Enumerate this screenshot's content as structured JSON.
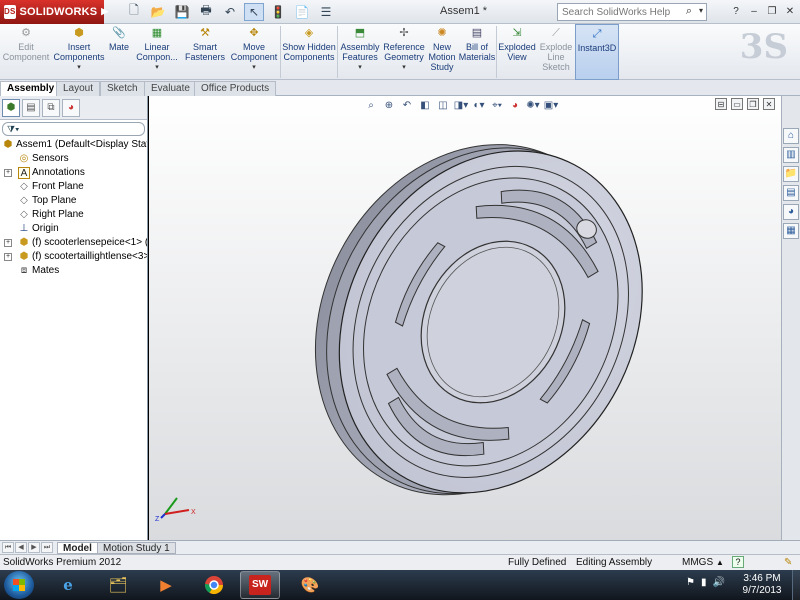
{
  "app": {
    "logo_text": "SOLIDWORKS",
    "logo_mark": "DS",
    "doc_title": "Assem1 *",
    "search_placeholder": "Search SolidWorks Help"
  },
  "commands": [
    {
      "id": "edit-component",
      "label": "Edit Component",
      "icon": "edit-component-icon",
      "enabled": false
    },
    {
      "id": "insert-components",
      "label": "Insert Components",
      "icon": "insert-components-icon",
      "enabled": true
    },
    {
      "id": "mate",
      "label": "Mate",
      "icon": "mate-icon",
      "enabled": true
    },
    {
      "id": "linear-component-pattern",
      "label": "Linear Compon...",
      "icon": "linear-pattern-icon",
      "enabled": true
    },
    {
      "id": "smart-fasteners",
      "label": "Smart Fasteners",
      "icon": "smart-fasteners-icon",
      "enabled": true
    },
    {
      "id": "move-component",
      "label": "Move Component",
      "icon": "move-component-icon",
      "enabled": true
    },
    {
      "id": "show-hidden-components",
      "label": "Show Hidden Components",
      "icon": "show-hidden-icon",
      "enabled": true
    },
    {
      "id": "assembly-features",
      "label": "Assembly Features",
      "icon": "assembly-features-icon",
      "enabled": true
    },
    {
      "id": "reference-geometry",
      "label": "Reference Geometry",
      "icon": "reference-geometry-icon",
      "enabled": true
    },
    {
      "id": "new-motion-study",
      "label": "New Motion Study",
      "icon": "motion-study-icon",
      "enabled": true
    },
    {
      "id": "bill-of-materials",
      "label": "Bill of Materials",
      "icon": "bom-icon",
      "enabled": true
    },
    {
      "id": "exploded-view",
      "label": "Exploded View",
      "icon": "exploded-view-icon",
      "enabled": true
    },
    {
      "id": "explode-line-sketch",
      "label": "Explode Line Sketch",
      "icon": "explode-line-icon",
      "enabled": false
    },
    {
      "id": "instant3d",
      "label": "Instant3D",
      "icon": "instant3d-icon",
      "enabled": true,
      "active": true
    }
  ],
  "tabs": [
    "Assembly",
    "Layout",
    "Sketch",
    "Evaluate",
    "Office Products"
  ],
  "active_tab": "Assembly",
  "tree": {
    "root": "Assem1  (Default<Display State",
    "items": [
      {
        "label": "Sensors",
        "icon": "sensors-icon",
        "expandable": false
      },
      {
        "label": "Annotations",
        "icon": "annotations-icon",
        "expandable": true
      },
      {
        "label": "Front Plane",
        "icon": "plane-icon",
        "expandable": false
      },
      {
        "label": "Top Plane",
        "icon": "plane-icon",
        "expandable": false
      },
      {
        "label": "Right Plane",
        "icon": "plane-icon",
        "expandable": false
      },
      {
        "label": "Origin",
        "icon": "origin-icon",
        "expandable": false
      },
      {
        "label": "(f) scooterlensepeice<1> (D",
        "icon": "part-icon",
        "expandable": true
      },
      {
        "label": "(f) scootertaillightlense<3>",
        "icon": "part-icon",
        "expandable": true
      },
      {
        "label": "Mates",
        "icon": "mates-icon",
        "expandable": false
      }
    ]
  },
  "bottom_tabs": [
    "Model",
    "Motion Study 1"
  ],
  "status": {
    "product": "SolidWorks Premium 2012",
    "state": "Fully Defined",
    "mode": "Editing Assembly",
    "units": "MMGS"
  },
  "triad": {
    "x": "X",
    "z": "Z"
  },
  "clock": {
    "time": "3:46 PM",
    "date": "9/7/2013"
  },
  "colors": {
    "brand_red": "#c8241d",
    "part_face": "#c4c7d6",
    "viewport_top": "#ffffff",
    "viewport_bottom": "#d9dbde",
    "taskbar": "#1a2430"
  }
}
